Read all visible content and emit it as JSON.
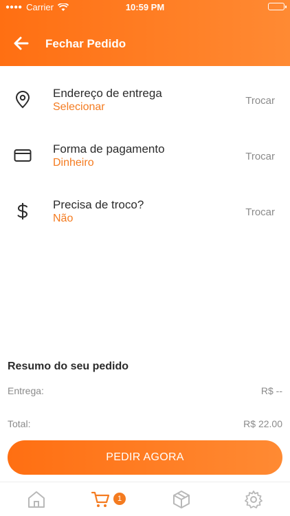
{
  "status_bar": {
    "carrier": "Carrier",
    "time": "10:59 PM"
  },
  "header": {
    "title": "Fechar Pedido"
  },
  "options": [
    {
      "label": "Endereço de entrega",
      "value": "Selecionar",
      "action": "Trocar",
      "icon": "location-pin-icon"
    },
    {
      "label": "Forma de pagamento",
      "value": "Dinheiro",
      "action": "Trocar",
      "icon": "credit-card-icon"
    },
    {
      "label": "Precisa de troco?",
      "value": "Não",
      "action": "Trocar",
      "icon": "dollar-icon"
    }
  ],
  "summary": {
    "title": "Resumo do seu pedido",
    "delivery_label": "Entrega:",
    "delivery_value": "R$ --",
    "total_label": "Total:",
    "total_value": "R$ 22.00"
  },
  "order_button": {
    "label": "PEDIR AGORA"
  },
  "tabbar": {
    "cart_badge": "1",
    "items": [
      "home-icon",
      "cart-icon",
      "box-icon",
      "gear-icon"
    ]
  },
  "colors": {
    "accent": "#f47b20",
    "header_start": "#ff6f12",
    "header_end": "#ff8a33",
    "muted": "#8a8a8a"
  }
}
